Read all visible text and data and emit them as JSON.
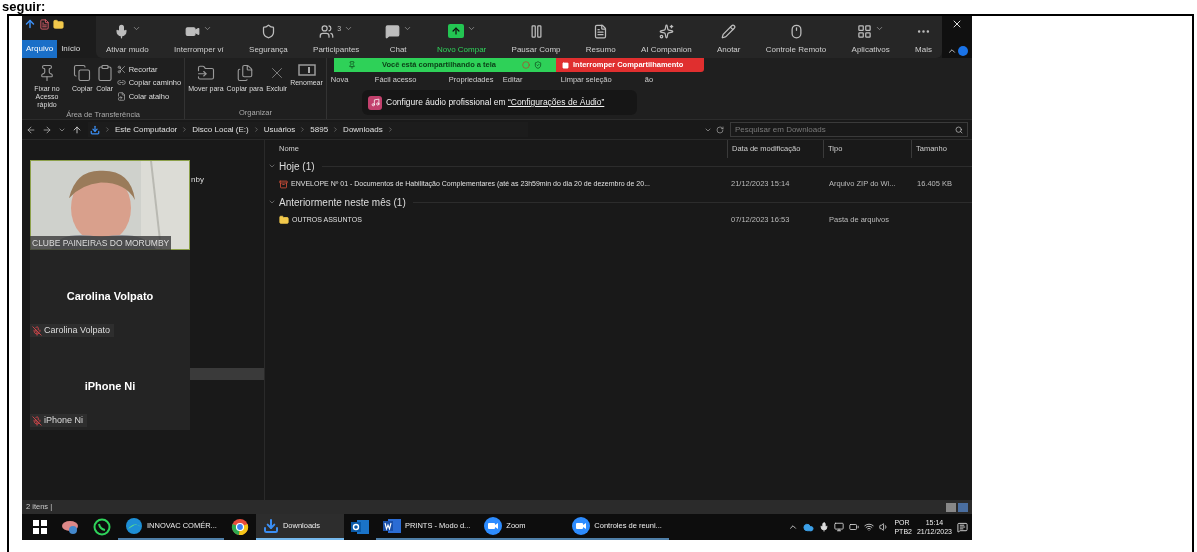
{
  "caption": "seguir:",
  "explorer": {
    "quick_tabs": [
      {
        "label": "Arquivo",
        "selected": true
      },
      {
        "label": "Início",
        "selected": false
      }
    ],
    "ribbon": {
      "groups": [
        {
          "label": "Área de Transferência",
          "big": [
            {
              "kind": "pin",
              "label": "Fixar no Acesso rápido"
            },
            {
              "kind": "copy",
              "label": "Copiar"
            },
            {
              "kind": "paste",
              "label": "Colar"
            }
          ],
          "small": [
            {
              "kind": "cut",
              "label": "Recortar"
            },
            {
              "kind": "path",
              "label": "Copiar caminho"
            },
            {
              "kind": "shortcut",
              "label": "Colar atalho"
            }
          ]
        },
        {
          "label": "Organizar",
          "big": [
            {
              "kind": "move",
              "label": "Mover para"
            },
            {
              "kind": "copyto",
              "label": "Copiar para"
            },
            {
              "kind": "delete",
              "label": "Excluir"
            },
            {
              "kind": "rename",
              "label": "Renomear"
            }
          ]
        }
      ],
      "partial": [
        {
          "label": "Nova"
        },
        {
          "label": "Fácil acesso"
        },
        {
          "label": "Propriedades"
        },
        {
          "label": "Editar"
        },
        {
          "label": "Limpar seleção"
        },
        {
          "label": "ão"
        }
      ]
    },
    "address": {
      "path": [
        "Este Computador",
        "Disco Local (E:)",
        "Usuários",
        "5895",
        "Downloads"
      ],
      "search_placeholder": "Pesquisar em Downloads"
    },
    "nav_partial": "nby",
    "columns": [
      "Nome",
      "Data de modificação",
      "Tipo",
      "Tamanho"
    ],
    "groups": [
      {
        "label": "Hoje (1)",
        "expanded": true,
        "rows": [
          {
            "kind": "zip",
            "name": "ENVELOPE Nº 01 - Documentos de Habilitação Complementares (até as 23h59min do dia 20 de dezembro de 20...",
            "date": "21/12/2023 15:14",
            "type": "Arquivo ZIP do Wi...",
            "size": "16.405 KB"
          }
        ]
      },
      {
        "label": "Anteriormente neste mês (1)",
        "expanded": true,
        "rows": [
          {
            "kind": "folder",
            "name": "OUTROS ASSUNTOS",
            "date": "07/12/2023 16:53",
            "type": "Pasta de arquivos"
          }
        ]
      }
    ],
    "status": "2 itens |"
  },
  "zoom": {
    "toolbar": [
      {
        "kind": "mic",
        "label": "Ativar mudo",
        "caret": true
      },
      {
        "kind": "video",
        "label": "Interromper ví",
        "caret": true
      },
      {
        "kind": "shield",
        "label": "Segurança",
        "caret": false
      },
      {
        "kind": "people",
        "label": "Participantes",
        "caret": true,
        "count": "3"
      },
      {
        "kind": "chat",
        "label": "Chat",
        "caret": true
      },
      {
        "kind": "share",
        "label": "Novo Compar",
        "caret": true
      },
      {
        "kind": "pause",
        "label": "Pausar Comp",
        "caret": false
      },
      {
        "kind": "summary",
        "label": "Resumo",
        "caret": false
      },
      {
        "kind": "sparkle",
        "label": "AI Companion",
        "caret": false
      },
      {
        "kind": "pen",
        "label": "Anotar",
        "caret": false
      },
      {
        "kind": "mouse",
        "label": "Controle Remoto",
        "caret": false
      },
      {
        "kind": "apps",
        "label": "Aplicativos",
        "caret": true
      },
      {
        "kind": "more",
        "label": "Mais",
        "caret": false
      }
    ],
    "share_banner": "Você está compartilhando a tela",
    "stop_share": "Interromper Compartilhamento",
    "tip": {
      "text": "Configure áudio profissional em",
      "link": "“Configurações de Áudio”"
    },
    "tiles": [
      {
        "kind": "video",
        "name": "CLUBE PAINEIRAS DO MORUMBY"
      },
      {
        "kind": "avatar",
        "title": "Carolina Volpato",
        "name": "Carolina Volpato",
        "muted": true
      },
      {
        "kind": "avatar",
        "title": "iPhone Ni",
        "name": "iPhone Ni",
        "muted": true
      }
    ]
  },
  "taskbar": {
    "apps": [
      {
        "kind": "start",
        "selected": false
      },
      {
        "kind": "drive",
        "selected": false
      },
      {
        "kind": "whatsapp",
        "selected": false
      },
      {
        "kind": "edge",
        "label": "INNOVAC COMÉR...",
        "selected": false
      },
      {
        "kind": "chrome",
        "selected": false
      },
      {
        "kind": "downloads",
        "label": "Downloads",
        "selected": true
      },
      {
        "kind": "outlook",
        "selected": false
      },
      {
        "kind": "word",
        "label": "PRINTS  -  Modo d...",
        "selected": false
      },
      {
        "kind": "zoom",
        "label": "Zoom",
        "selected": false
      },
      {
        "kind": "zoom",
        "label": "Controles de reuni...",
        "selected": false
      }
    ],
    "lang": "POR",
    "layout": "PTB2",
    "time": "15:14",
    "date": "21/12/2023"
  }
}
